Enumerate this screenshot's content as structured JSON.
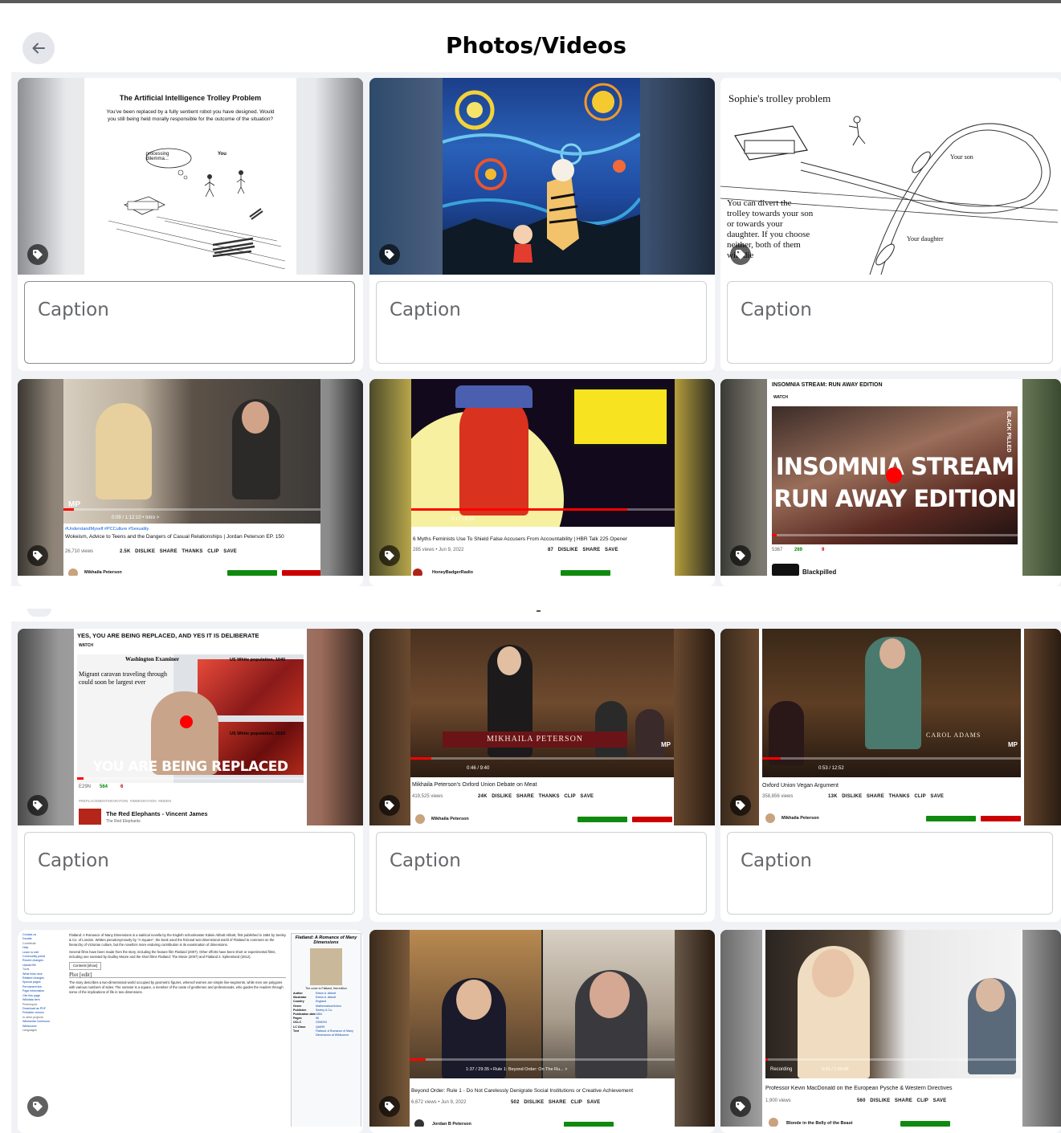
{
  "header": {
    "title": "Photos/Videos",
    "back_icon": "arrow-left-icon"
  },
  "caption_placeholder": "Caption",
  "colors": {
    "panel_bg": "#f0f2f5",
    "accent_red": "#ff0000",
    "subscribe_green": "#0f8a0f"
  },
  "cards": [
    {
      "title": "The Artificial Intelligence Trolley Problem",
      "body": "You've been replaced by a fully sentient robot you have designed. Would you still being held morally responsible for the outcome of the situation?",
      "bubble": "processing dilemma...",
      "you_label": "You"
    },
    {
      "kind": "painting",
      "description_label": ""
    },
    {
      "title": "Sophie's trolley problem",
      "body": "You can divert the trolley towards your son or towards your daughter. If you choose neither, both of them will die",
      "label_son": "Your son",
      "label_daughter": "Your daughter"
    },
    {
      "hashtags": "#UnderstandMyself #PCCulture #Sexuality",
      "video_title": "Wokeism, Advice to Teens and the Dangers of Casual Relationships | Jordan Peterson EP. 150",
      "views": "26,710 views",
      "likes": "2.5K",
      "time": "0:09 / 1:12:10 • Intro >",
      "channel": "Mikhaila Peterson",
      "watermark": "MP",
      "actions": [
        "DISLIKE",
        "SHARE",
        "THANKS",
        "CLIP",
        "SAVE"
      ]
    },
    {
      "video_title": "6 Myths Feminists Use To Shield False Accusers From Accountability | HBR Talk 225 Opener",
      "views": "285 views • Jun 9, 2022",
      "likes": "87",
      "time": "5:17 / 6:23",
      "channel": "HoneyBadgerRadio",
      "actions": [
        "DISLIKE",
        "SHARE",
        "SAVE"
      ]
    },
    {
      "page_heading": "INSOMNIA STREAM: RUN AWAY EDITION",
      "watch_label": "WATCH",
      "overlay_line1": "INSOMNIA STREAM",
      "overlay_line2": "RUN AWAY EDITION",
      "brand": "BLACK PILLED",
      "views": "5367",
      "likes": "269",
      "dislikes": "9",
      "channel": "Blackpilled"
    },
    {
      "page_heading": "YES, YOU ARE BEING REPLACED, AND YES IT IS DELIBERATE",
      "watch_label": "WATCH",
      "newspaper": "Washington Examiner",
      "headline": "Migrant caravan traveling through could soon be largest ever",
      "map1_label": "US White population, 1940",
      "map2_label": "US White population, 2010",
      "overlay": "YOU ARE BEING REPLACED",
      "views": "E29N",
      "likes": "564",
      "dislikes": "6",
      "tags": [
        "#REPLACEMENTMIGRATION",
        "#IMMIGRATION",
        "#BIDEN"
      ],
      "related_title": "The Red Elephants - Vincent James",
      "related_channel": "The Red Elephants"
    },
    {
      "lower_third": "MIKHAILA PETERSON",
      "watermark": "MP",
      "time": "0:46 / 9:40",
      "video_title": "Mikhaila Peterson's Oxford Union Debate on Meat",
      "views": "419,525 views",
      "likes": "24K",
      "channel": "Mikhaila Peterson",
      "actions": [
        "DISLIKE",
        "SHARE",
        "THANKS",
        "CLIP",
        "SAVE"
      ]
    },
    {
      "lower_third": "CAROL ADAMS",
      "watermark": "MP",
      "time": "0:53 / 12:52",
      "video_title": "Oxford Union Vegan Argument",
      "views": "358,856 views",
      "likes": "13K",
      "channel": "Mikhaila Peterson",
      "actions": [
        "DISLIKE",
        "SHARE",
        "THANKS",
        "CLIP",
        "SAVE"
      ]
    },
    {
      "article_title": "Flatland: A Romance of Many Dimensions",
      "lede": "Flatland: A Romance of Many Dimensions is a satirical novella by the English schoolmaster Edwin Abbott Abbott, first published in 1884 by Seeley & Co. of London. Written pseudonymously by \"A Square\", the book used the fictional two-dimensional world of Flatland to comment on the hierarchy of Victorian culture, but the novella's more enduring contribution is its examination of dimensions.",
      "films": "Several films have been made from the story, including the feature film Flatland (2007). Other efforts have been short or experimental films, including one narrated by Dudley Moore and the short films Flatland: The Movie (2007) and Flatland 2: Sphereland (2012).",
      "contents": "Contents [show]",
      "plot_heading": "Plot [edit]",
      "plot": "The story describes a two-dimensional world occupied by geometric figures, whereof women are simple line-segments, while men are polygons with various numbers of sides. The narrator is a square, a member of the caste of gentlemen and professionals, who guides the readers through some of the implications of life in two dimensions.",
      "infobox_title": "Flatland: A Romance of Many Dimensions",
      "infobox_caption": "The cover to Flatland, first edition",
      "infobox_rows": [
        [
          "Author",
          "Edwin A. Abbott"
        ],
        [
          "Illustrator",
          "Edwin A. Abbott"
        ],
        [
          "Country",
          "England"
        ],
        [
          "Genre",
          "Mathematical fiction"
        ],
        [
          "Publisher",
          "Seeley & Co."
        ],
        [
          "Publication date",
          "1884"
        ],
        [
          "Pages",
          "96"
        ],
        [
          "OCLC",
          "2306204"
        ],
        [
          "LC Class",
          "QA699"
        ],
        [
          "Text",
          "Flatland: A Romance of Many Dimensions at Wikisource"
        ]
      ],
      "sidebar": [
        "Contact us",
        "Donate",
        "Contribute",
        "Help",
        "Learn to edit",
        "Community portal",
        "Recent changes",
        "Upload file",
        "Tools",
        "What links here",
        "Related changes",
        "Special pages",
        "Permanent link",
        "Page information",
        "Cite this page",
        "Wikidata item",
        "Print/export",
        "Download as PDF",
        "Printable version",
        "In other projects",
        "Wikimedia Commons",
        "Wikisource",
        "Languages"
      ]
    },
    {
      "video_title": "Beyond Order: Rule 1 - Do Not Carelessly Denigrate Social Institutions or Creative Achievement",
      "views": "6,672 views • Jun 9, 2022",
      "likes": "502",
      "time": "1:37 / 29:35 • Rule 1: Beyond Order: On The Ru... >",
      "channel": "Jordan B Peterson",
      "actions": [
        "DISLIKE",
        "SHARE",
        "CLIP",
        "SAVE"
      ]
    },
    {
      "video_title": "Professor Kevin MacDonald on the European Pysche & Western Directives",
      "views": "1,900 views",
      "likes": "560",
      "time": "0:01 / 1:00:06",
      "recording_label": "Recording",
      "channel": "Blonde in the Belly of the Beast",
      "actions": [
        "DISLIKE",
        "SHARE",
        "CLIP",
        "SAVE"
      ]
    }
  ]
}
